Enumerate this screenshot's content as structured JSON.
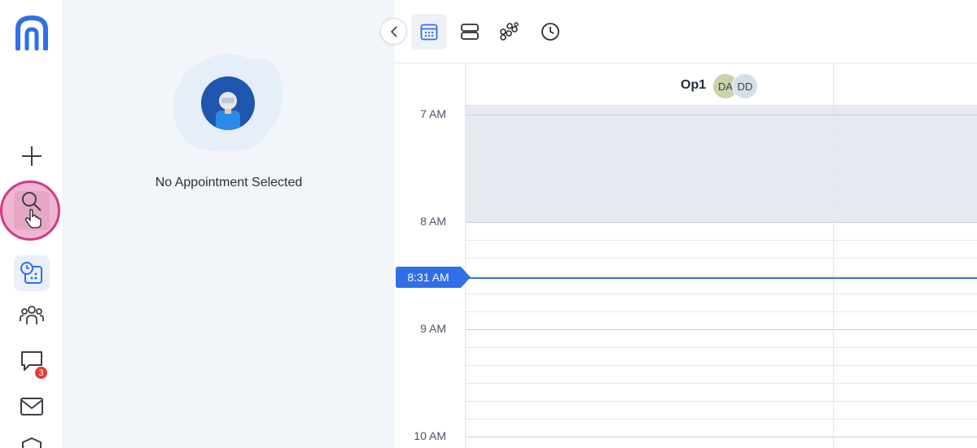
{
  "rail": {
    "items": [
      {
        "name": "add",
        "icon": "plus-icon"
      },
      {
        "name": "search",
        "icon": "search-icon"
      },
      {
        "name": "schedule",
        "icon": "calendar-clock-icon",
        "active": true
      },
      {
        "name": "patients",
        "icon": "users-icon"
      },
      {
        "name": "messages",
        "icon": "chat-icon",
        "badge": "3"
      },
      {
        "name": "mail",
        "icon": "mail-icon"
      },
      {
        "name": "security",
        "icon": "shield-icon"
      }
    ]
  },
  "panel": {
    "empty_message": "No Appointment Selected"
  },
  "toolbar": {
    "tools": [
      "calendar-icon",
      "rows-icon",
      "coins-icon",
      "clock-icon"
    ]
  },
  "calendar": {
    "column": {
      "label": "Op1",
      "providers": [
        {
          "initials": "DA",
          "color": "#c8d5a8"
        },
        {
          "initials": "DD",
          "color": "#d5dfe6"
        }
      ]
    },
    "times": [
      "7 AM",
      "8 AM",
      "9 AM",
      "10 AM"
    ],
    "current_time": "8:31 AM"
  },
  "colors": {
    "accent": "#2f6fe8",
    "now_tag": "#2f6fe8",
    "hover_ring": "#d23a86",
    "badge": "#e53935"
  }
}
